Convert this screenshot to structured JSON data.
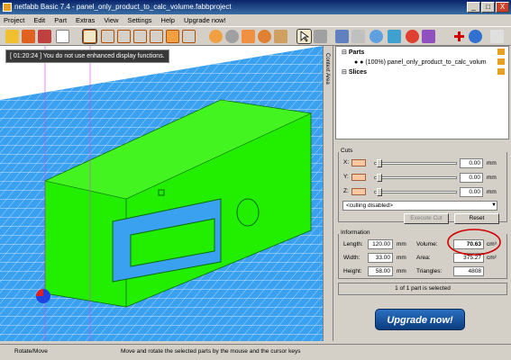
{
  "window": {
    "title": "netfabb Basic 7.4 - panel_only_product_to_calc_volume.fabbproject",
    "buttons": [
      "_",
      "□",
      "X"
    ]
  },
  "menu": [
    "Project",
    "Edit",
    "Part",
    "Extras",
    "View",
    "Settings",
    "Help",
    "Upgrade now!"
  ],
  "viewport": {
    "tooltip": "[ 01:20:24 ] You do not use enhanced display functions."
  },
  "side_tab": "Context Area",
  "tree": {
    "parts_label": "Parts",
    "part_name": "(100%) panel_only_product_to_calc_volum",
    "slices_label": "Slices"
  },
  "cuts": {
    "title": "Cuts",
    "axes": [
      {
        "label": "X:",
        "value": "0.00",
        "unit": "mm"
      },
      {
        "label": "Y:",
        "value": "0.00",
        "unit": "mm"
      },
      {
        "label": "Z:",
        "value": "0.00",
        "unit": "mm"
      }
    ],
    "culling": "<culling disabled>",
    "execute": "Execute Cut",
    "reset": "Reset"
  },
  "info": {
    "title": "Information",
    "length_label": "Length:",
    "length": "120.00",
    "width_label": "Width:",
    "width": "33.00",
    "height_label": "Height:",
    "height": "58.00",
    "unit": "mm",
    "volume_label": "Volume:",
    "volume": "70.63",
    "volume_unit": "cm³",
    "area_label": "Area:",
    "area": "375.27",
    "area_unit": "cm²",
    "triangles_label": "Triangles:",
    "triangles": "4808",
    "selected": "1 of 1 part is selected"
  },
  "upgrade_button": "Upgrade now!",
  "status": {
    "mode": "Rotate/Move",
    "hint": "Move and rotate the selected parts by the mouse and the cursor keys"
  },
  "colors": {
    "model": "#22ee00",
    "grid": "#3aa0f0",
    "highlight": "#d00000"
  }
}
